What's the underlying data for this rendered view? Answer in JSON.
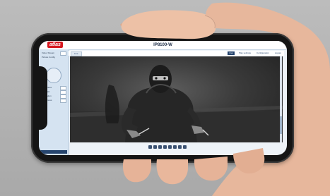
{
  "app": {
    "logo_text": "atlas",
    "device_title": "IP8100-W"
  },
  "nav": {
    "live_tab": "Live",
    "links": [
      "Live",
      "Play settings",
      "Configuration",
      "Logout"
    ]
  },
  "sidebar": {
    "items": [
      "Video Stream",
      "Picture Config",
      "Brightness",
      "Contrast",
      "Saturation",
      "Sharpness"
    ]
  },
  "toolbar": {
    "buttons": [
      "snapshot",
      "record",
      "zoom-in",
      "zoom-out",
      "fullscreen",
      "audio",
      "talk",
      "settings"
    ]
  },
  "scene": {
    "subject": "masked-intruder",
    "colors": {
      "backdrop": "#b3b3b3",
      "phone_body": "#151515",
      "ui_accent": "#26456e",
      "logo": "#d71920"
    }
  }
}
